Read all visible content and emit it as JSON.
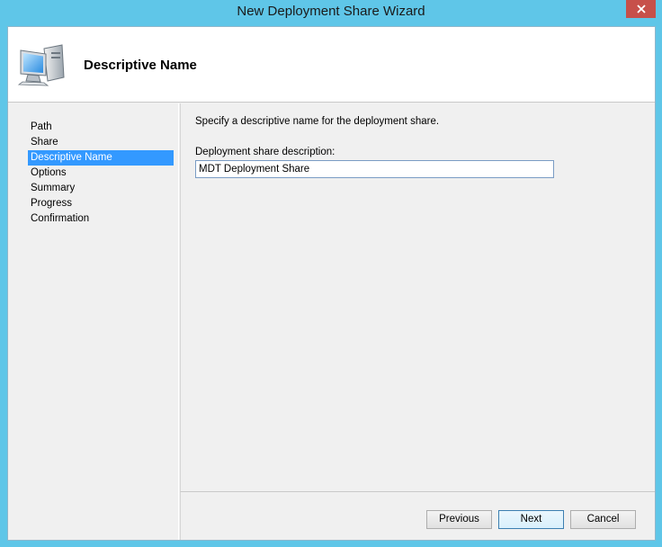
{
  "window": {
    "title": "New Deployment Share Wizard",
    "close_icon": "close-icon"
  },
  "header": {
    "title": "Descriptive Name",
    "icon": "computer-icon"
  },
  "sidebar": {
    "items": [
      {
        "label": "Path",
        "active": false
      },
      {
        "label": "Share",
        "active": false
      },
      {
        "label": "Descriptive Name",
        "active": true
      },
      {
        "label": "Options",
        "active": false
      },
      {
        "label": "Summary",
        "active": false
      },
      {
        "label": "Progress",
        "active": false
      },
      {
        "label": "Confirmation",
        "active": false
      }
    ]
  },
  "main": {
    "instruction": "Specify a descriptive name for the deployment share.",
    "field_label": "Deployment share description:",
    "field_value": "MDT Deployment Share"
  },
  "footer": {
    "previous_label": "Previous",
    "next_label": "Next",
    "cancel_label": "Cancel"
  },
  "colors": {
    "frame": "#5fc6e8",
    "close": "#c7504a",
    "selection": "#3399ff"
  }
}
